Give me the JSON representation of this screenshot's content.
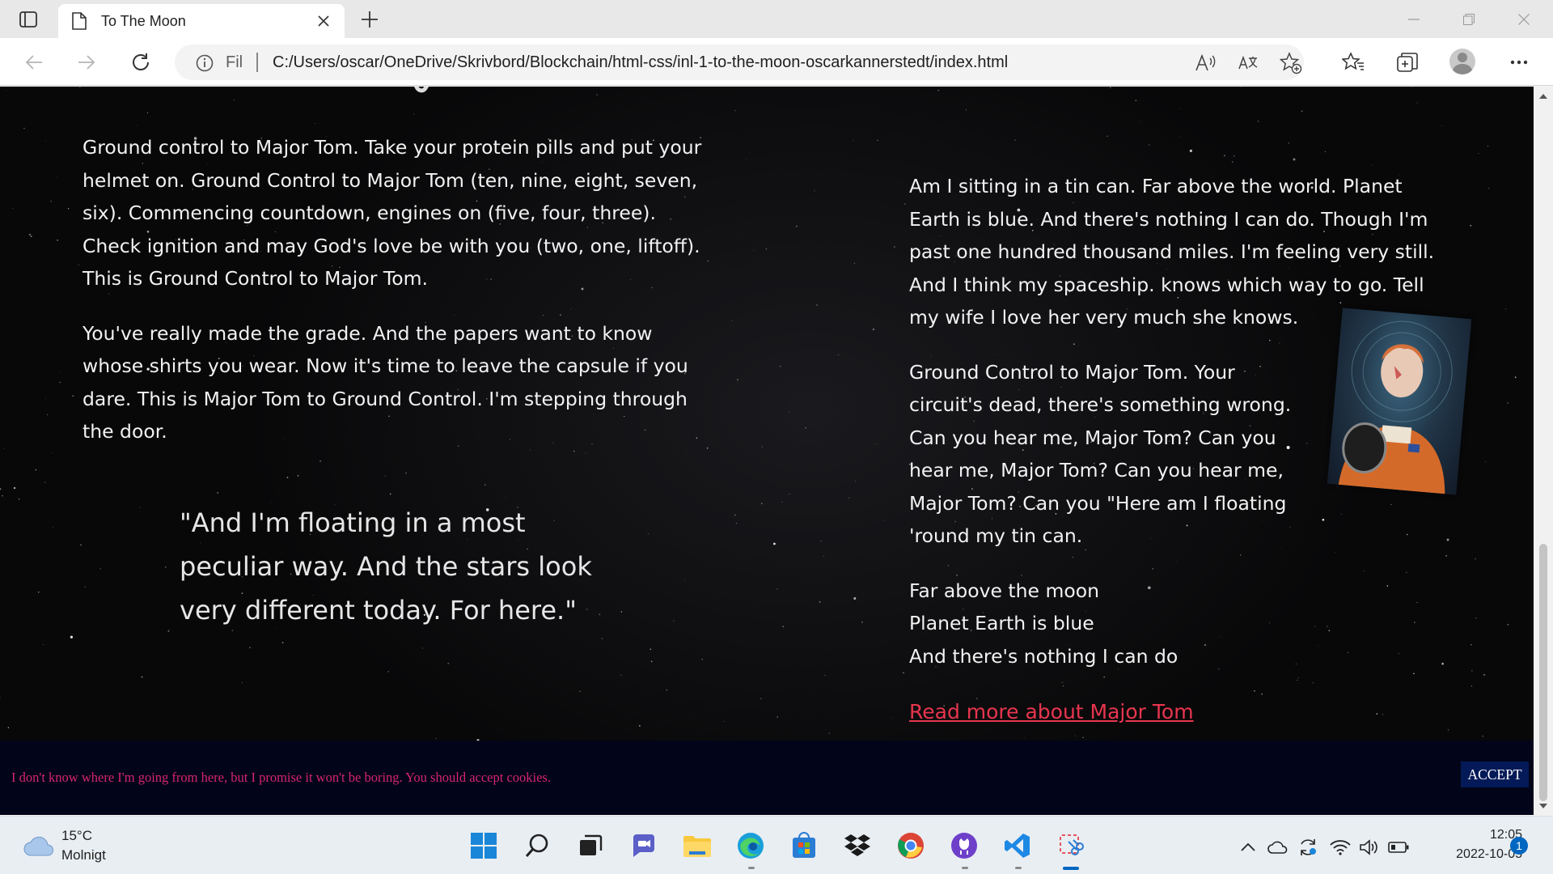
{
  "browser": {
    "tab_title": "To The Moon",
    "site_label": "Fil",
    "url": "C:/Users/oscar/OneDrive/Skrivbord/Blockchain/html-css/inl-1-to-the-moon-oscarkannerstedt/index.html"
  },
  "page": {
    "left_column": {
      "paragraphs": [
        "Ground control to Major Tom. Take your protein pills and put your helmet on. Ground Control to Major Tom (ten, nine, eight, seven, six). Commencing countdown, engines on (five, four, three). Check ignition and may God's love be with you (two, one, liftoff). This is Ground Control to Major Tom.",
        "You've really made the grade. And the papers want to know whose shirts you wear. Now it's time to leave the capsule if you dare. This is Major Tom to Ground Control. I'm stepping through the door."
      ],
      "quote": "\"And I'm floating in a most peculiar way. And the stars look very different today. For here.\""
    },
    "right_column": {
      "paragraphs": [
        "Am I sitting in a tin can. Far above the world. Planet Earth is blue. And there's nothing I can do. Though I'm past one hundred thousand miles. I'm feeling very still. And I think my spaceship. knows which way to go. Tell my wife I love her very much she knows.",
        "Ground Control to Major Tom. Your circuit's dead, there's something wrong. Can you hear me, Major Tom? Can you hear me, Major Tom? Can you hear me, Major Tom? Can you \"Here am I floating 'round my tin can."
      ],
      "lines": [
        "Far above the moon",
        "Planet Earth is blue",
        "And there's nothing I can do"
      ],
      "link": "Read more about Major Tom"
    },
    "cookie_banner": {
      "text": "I don't know where I'm going from here, but I promise it won't be boring. You should accept cookies.",
      "button": "ACCEPT"
    }
  },
  "taskbar": {
    "weather_temp": "15°C",
    "weather_desc": "Molnigt",
    "clock_time": "12:05",
    "clock_date": "2022-10-05",
    "notification_count": "1"
  }
}
